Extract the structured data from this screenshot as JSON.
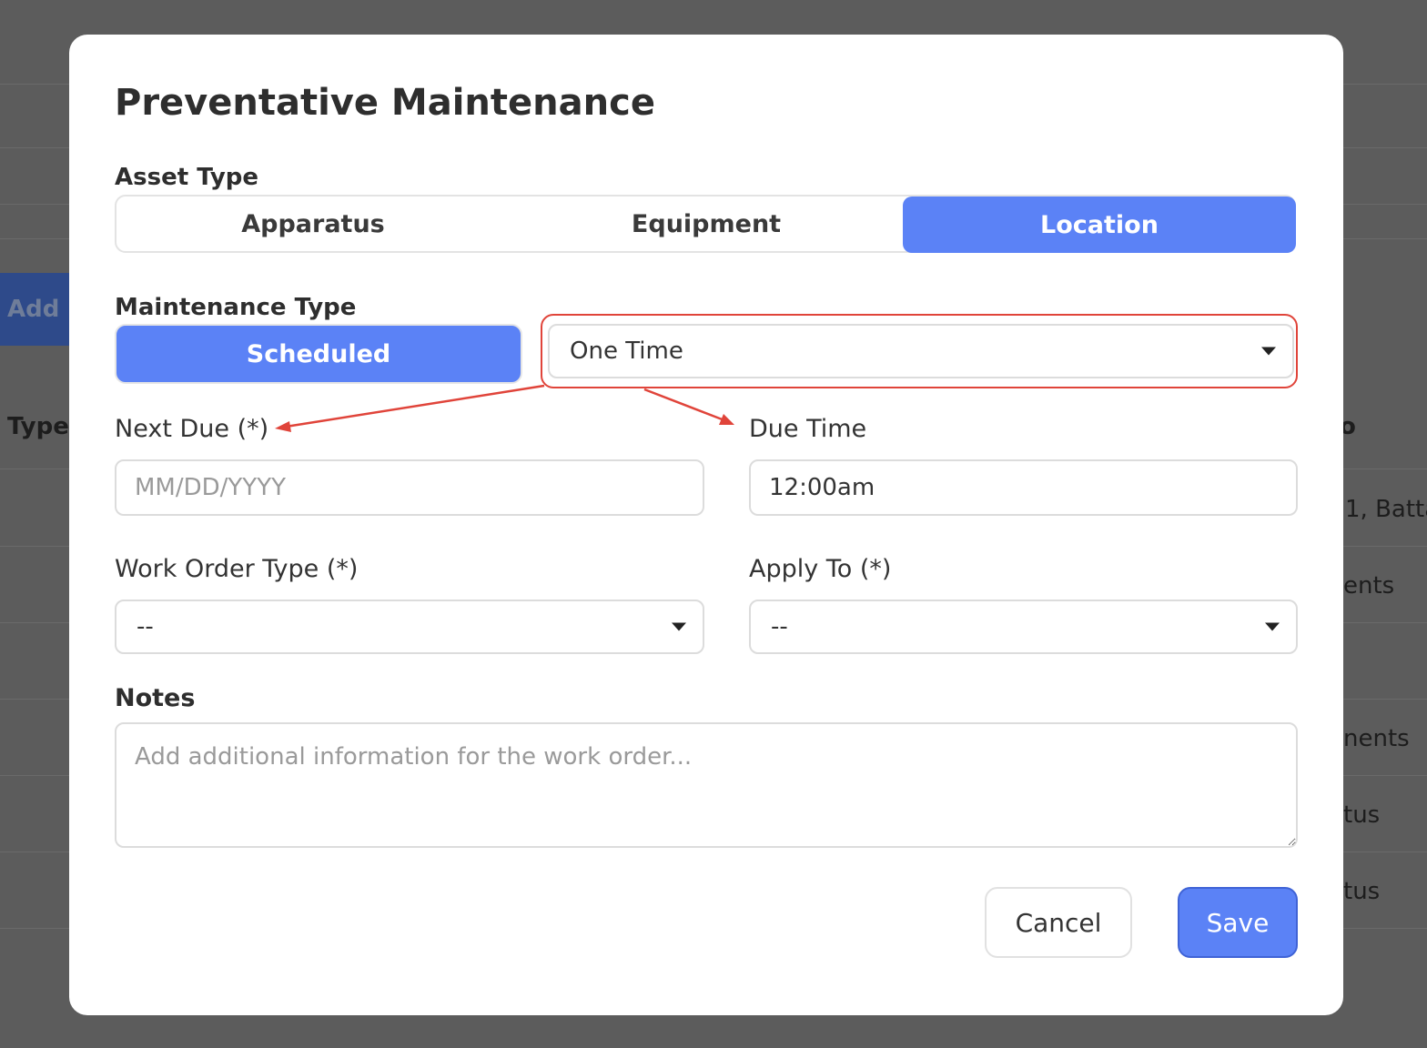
{
  "background": {
    "add_button_label": "Add M",
    "column_header": "Type",
    "right_fragments": [
      "o",
      "1, Batta",
      "ents",
      "nents",
      "tus",
      "tus"
    ]
  },
  "modal": {
    "title": "Preventative Maintenance",
    "asset_type": {
      "label": "Asset Type",
      "options": [
        "Apparatus",
        "Equipment",
        "Location"
      ],
      "selected": "Location"
    },
    "maintenance_type": {
      "label": "Maintenance Type",
      "toggle_label": "Scheduled",
      "frequency_value": "One Time"
    },
    "next_due": {
      "label": "Next Due (*)",
      "placeholder": "MM/DD/YYYY",
      "value": ""
    },
    "due_time": {
      "label": "Due Time",
      "value": "12:00am"
    },
    "work_order_type": {
      "label": "Work Order Type (*)",
      "value": "--"
    },
    "apply_to": {
      "label": "Apply To (*)",
      "value": "--"
    },
    "notes": {
      "label": "Notes",
      "placeholder": "Add additional information for the work order..."
    },
    "buttons": {
      "cancel": "Cancel",
      "save": "Save"
    }
  },
  "colors": {
    "accent": "#5b82f6",
    "annotation": "#e0443a",
    "overlay": "#5c5c5c"
  }
}
